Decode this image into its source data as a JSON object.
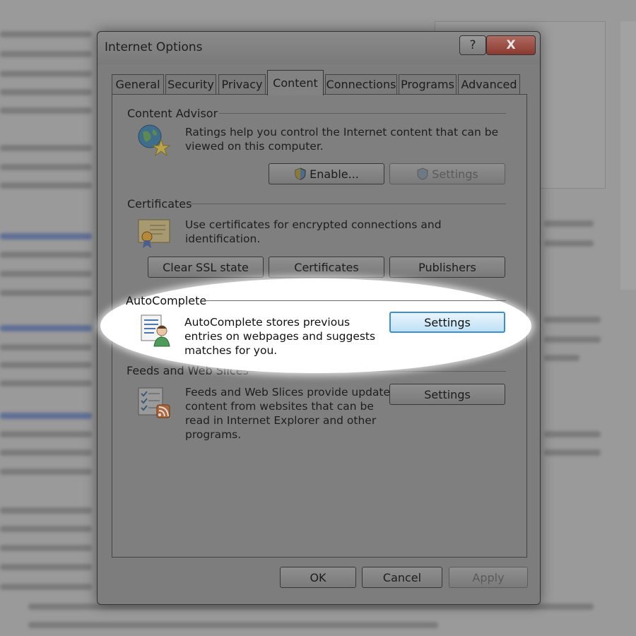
{
  "dialog": {
    "title": "Internet Options",
    "help_label": "?",
    "close_label": "X"
  },
  "tabs": [
    {
      "label": "General"
    },
    {
      "label": "Security"
    },
    {
      "label": "Privacy"
    },
    {
      "label": "Content",
      "active": true
    },
    {
      "label": "Connections"
    },
    {
      "label": "Programs"
    },
    {
      "label": "Advanced"
    }
  ],
  "content_advisor": {
    "title": "Content Advisor",
    "description": "Ratings help you control the Internet content that can be viewed on this computer.",
    "enable_label": "Enable...",
    "settings_label": "Settings",
    "icon": "globe-star-icon"
  },
  "certificates": {
    "title": "Certificates",
    "description": "Use certificates for encrypted connections and identification.",
    "clear_ssl_label": "Clear SSL state",
    "certificates_label": "Certificates",
    "publishers_label": "Publishers",
    "icon": "certificate-icon"
  },
  "autocomplete": {
    "title": "AutoComplete",
    "description": "AutoComplete stores previous entries on webpages and suggests matches for you.",
    "settings_label": "Settings",
    "icon": "autocomplete-user-icon"
  },
  "feeds": {
    "title": "Feeds and Web Slices",
    "description": "Feeds and Web Slices provide updated content from websites that can be read in Internet Explorer and other programs.",
    "settings_label": "Settings",
    "icon": "feeds-list-icon"
  },
  "footer": {
    "ok_label": "OK",
    "cancel_label": "Cancel",
    "apply_label": "Apply"
  },
  "colors": {
    "highlight": "#ffffff",
    "focus_border": "#3c8fcf",
    "dim_background": "#8f8f8f"
  }
}
